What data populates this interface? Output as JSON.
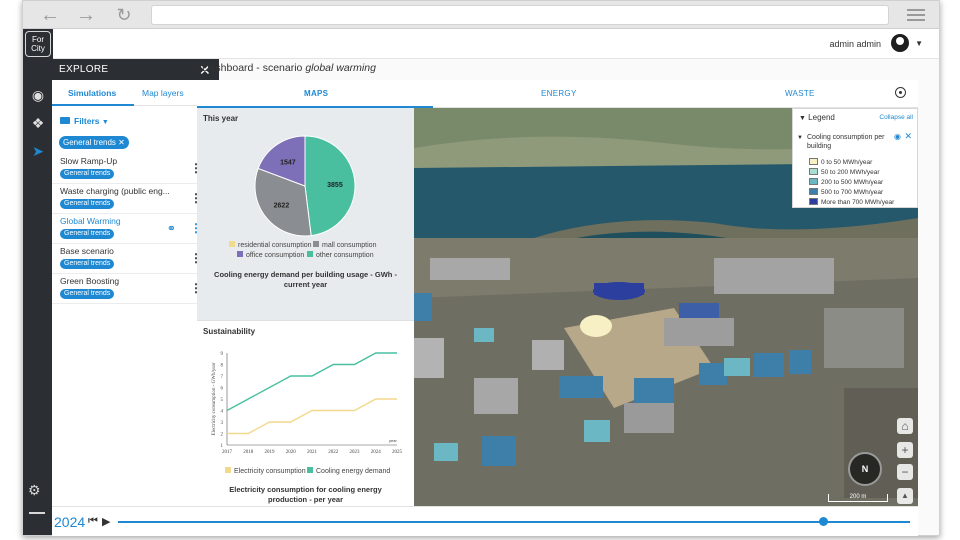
{
  "app": {
    "logo_text": "For City",
    "user_name": "admin admin"
  },
  "explore": {
    "title": "EXPLORE",
    "tabs": [
      "Simulations",
      "Map layers"
    ],
    "filters_label": "Filters",
    "active_filter": "General trends",
    "scenarios": [
      {
        "name": "Slow Ramp-Up",
        "badge": "General trends",
        "selected": false
      },
      {
        "name": "Waste charging (public eng...",
        "badge": "General trends",
        "selected": false
      },
      {
        "name": "Global Warming",
        "badge": "General trends",
        "selected": true
      },
      {
        "name": "Base scenario",
        "badge": "General trends",
        "selected": false
      },
      {
        "name": "Green Boosting",
        "badge": "General trends",
        "selected": false
      }
    ]
  },
  "dashboard": {
    "title_prefix": "Dashboard - scenario ",
    "title_scenario": "global warming",
    "tabs": [
      "MAPS",
      "ENERGY",
      "WASTE"
    ]
  },
  "pie_card": {
    "heading": "This year",
    "caption_line1": "Cooling energy demand per building usage - GWh -",
    "caption_line2": "current year",
    "legend": [
      {
        "label": "residential consumption",
        "color": "#f3d98b"
      },
      {
        "label": "mall consumption",
        "color": "#8a8d91"
      },
      {
        "label": "office consumption",
        "color": "#7e70b8"
      },
      {
        "label": "other consumption",
        "color": "#49bfa0"
      }
    ]
  },
  "line_card": {
    "heading": "Sustainability",
    "ylabel": "Electricity consumption - GWh/year",
    "caption_line1": "Electricity consumption for cooling energy",
    "caption_line2": "production - per year",
    "legend": [
      {
        "label": "Electricity consumption",
        "color": "#f3d98b"
      },
      {
        "label": "Cooling energy demand",
        "color": "#49bfa0"
      }
    ],
    "year_tag": "year"
  },
  "chart_data": [
    {
      "type": "pie",
      "slices": [
        {
          "label": "residential consumption",
          "value": 0,
          "color": "#f3d98b"
        },
        {
          "label": "mall consumption",
          "value": 2622,
          "color": "#8a8d91"
        },
        {
          "label": "office consumption",
          "value": 1547,
          "color": "#7e70b8"
        },
        {
          "label": "other consumption",
          "value": 3855,
          "color": "#49bfa0"
        }
      ]
    },
    {
      "type": "line",
      "x": [
        "2017",
        "2018",
        "2019",
        "2020",
        "2021",
        "2022",
        "2023",
        "2024",
        "2025"
      ],
      "ylim": [
        1,
        9
      ],
      "yticks": [
        "1",
        "2",
        "3",
        "4",
        "5",
        "6",
        "7",
        "8",
        "9"
      ],
      "series": [
        {
          "name": "Electricity consumption",
          "color": "#f3d98b",
          "values": [
            2,
            2,
            3,
            3,
            4,
            4,
            4,
            5,
            5
          ]
        },
        {
          "name": "Cooling energy demand",
          "color": "#49bfa0",
          "values": [
            4,
            5,
            6,
            7,
            7,
            8,
            8,
            9,
            9
          ]
        }
      ]
    }
  ],
  "map_legend": {
    "title": "Legend",
    "collapse_label": "Collapse all",
    "layer_title": "Cooling consumption per building",
    "items": [
      {
        "label": "0 to 50 MWh/year",
        "color": "#f6f0c4"
      },
      {
        "label": "50 to 200 MWh/year",
        "color": "#a9ddd4"
      },
      {
        "label": "200 to 500 MWh/year",
        "color": "#6bb8c4"
      },
      {
        "label": "500 to 700 MWh/year",
        "color": "#3d7fa8"
      },
      {
        "label": "More than 700 MWh/year",
        "color": "#2c3f9e"
      }
    ]
  },
  "map": {
    "compass_label": "N",
    "scale_label": "200 m"
  },
  "timeline": {
    "year": "2024",
    "progress": 0.89
  }
}
